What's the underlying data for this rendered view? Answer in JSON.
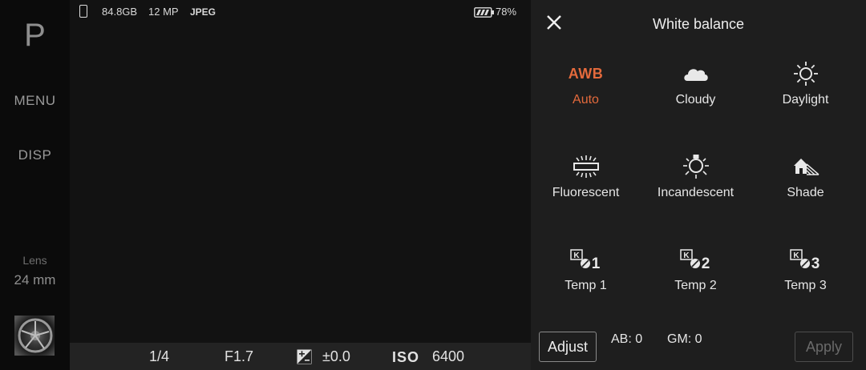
{
  "left_rail": {
    "mode": "P",
    "menu_label": "MENU",
    "disp_label": "DISP",
    "lens_label": "Lens",
    "lens_value": "24 mm"
  },
  "status_bar": {
    "storage": "84.8GB",
    "resolution": "12 MP",
    "format": "JPEG",
    "battery_percent": "78%"
  },
  "exposure_bar": {
    "shutter": "1/4",
    "aperture": "F1.7",
    "exposure_comp": "±0.0",
    "iso_label": "ISO",
    "iso_value": "6400"
  },
  "white_balance_panel": {
    "title": "White balance",
    "selected": "Auto",
    "awb_icon_text": "AWB",
    "options": [
      {
        "label": "Auto",
        "icon": "awb-icon"
      },
      {
        "label": "Cloudy",
        "icon": "cloud-icon"
      },
      {
        "label": "Daylight",
        "icon": "sun-icon"
      },
      {
        "label": "Fluorescent",
        "icon": "fluorescent-icon"
      },
      {
        "label": "Incandescent",
        "icon": "bulb-icon"
      },
      {
        "label": "Shade",
        "icon": "shade-icon"
      },
      {
        "label": "Temp 1",
        "icon": "temp-1-icon"
      },
      {
        "label": "Temp 2",
        "icon": "temp-2-icon"
      },
      {
        "label": "Temp 3",
        "icon": "temp-3-icon"
      }
    ],
    "adjust_label": "Adjust",
    "ab_value": "AB: 0",
    "gm_value": "GM: 0",
    "apply_label": "Apply",
    "accent_color": "#e46a3c"
  }
}
